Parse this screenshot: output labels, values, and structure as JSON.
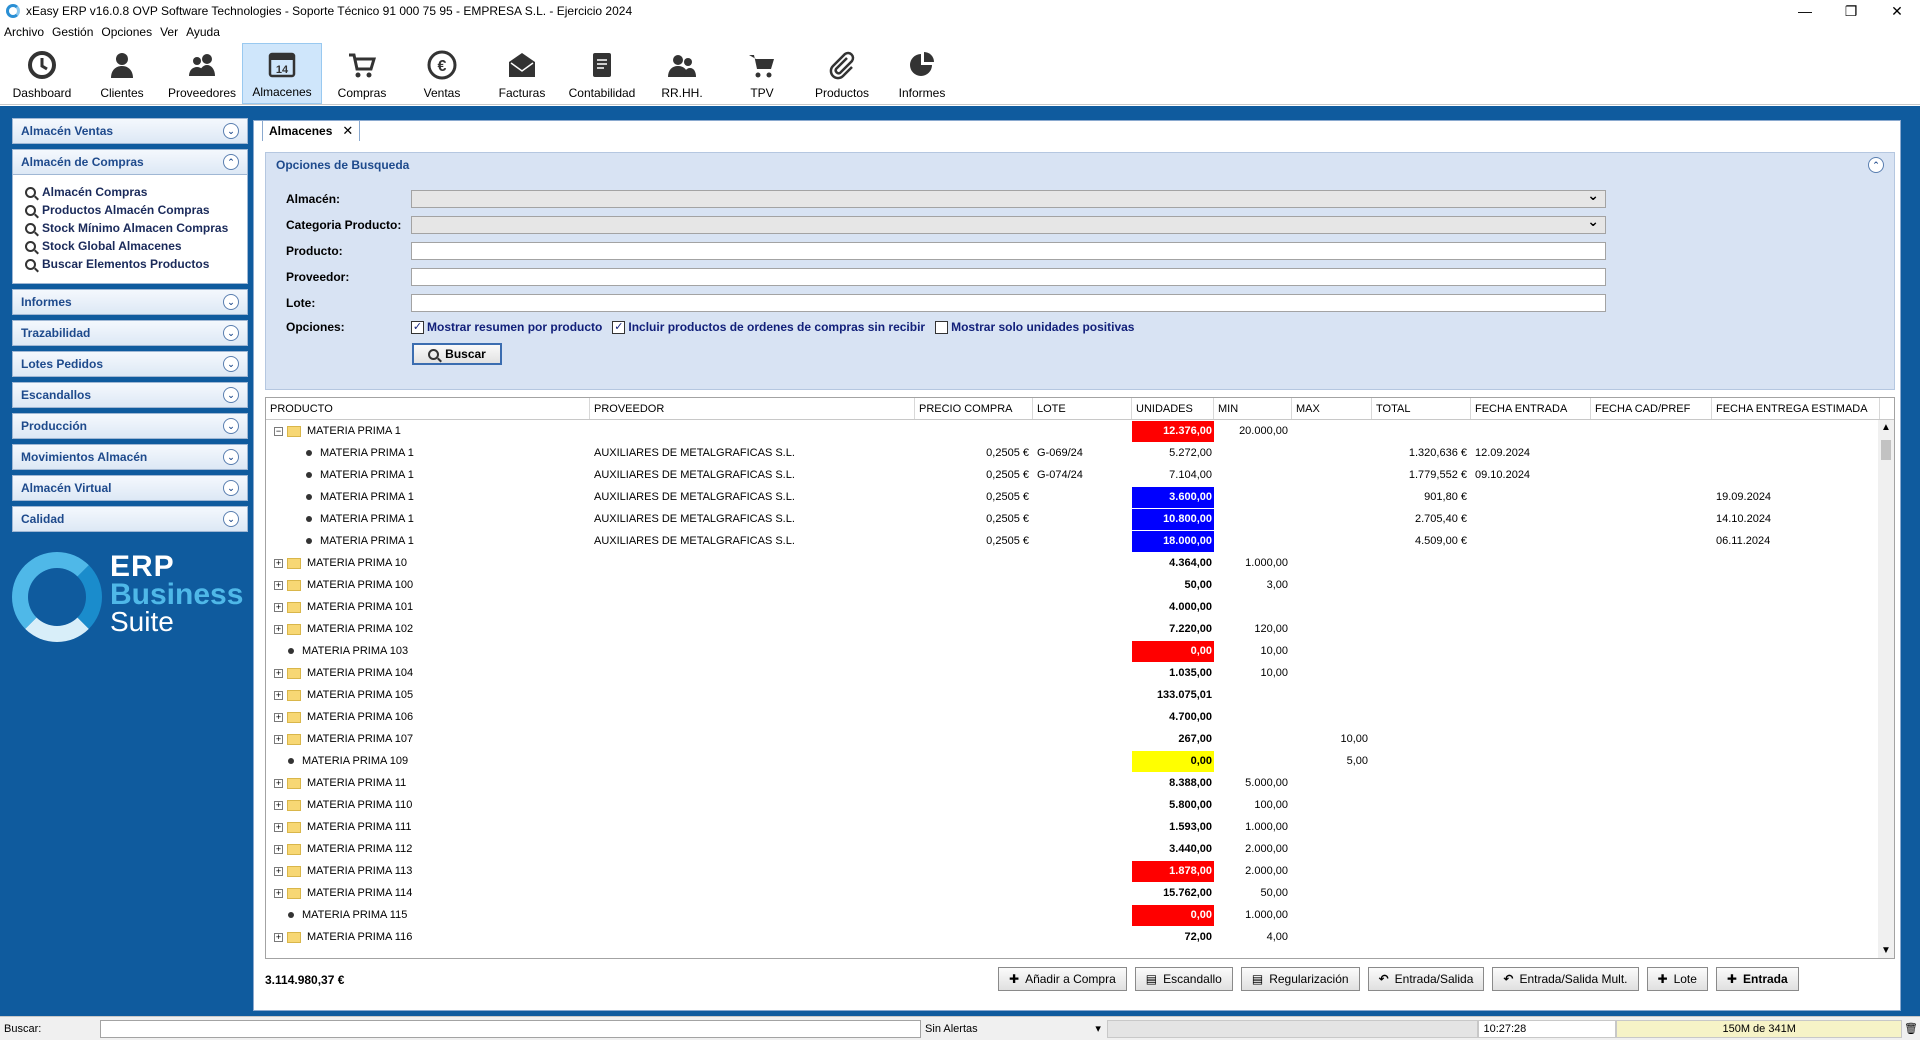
{
  "window": {
    "title": "xEasy ERP v16.0.8 OVP Software Technologies - Soporte Técnico 91 000 75 95 - EMPRESA S.L. - Ejercicio 2024",
    "minimize": "—",
    "maximize": "❐",
    "close": "✕"
  },
  "menu": [
    "Archivo",
    "Gestión",
    "Opciones",
    "Ver",
    "Ayuda"
  ],
  "toolbar": [
    {
      "label": "Dashboard",
      "icon": "clock-icon"
    },
    {
      "label": "Clientes",
      "icon": "person-icon"
    },
    {
      "label": "Proveedores",
      "icon": "people-icon"
    },
    {
      "label": "Almacenes",
      "icon": "calendar-icon",
      "day": "14",
      "active": true
    },
    {
      "label": "Compras",
      "icon": "cart-icon"
    },
    {
      "label": "Ventas",
      "icon": "euro-icon"
    },
    {
      "label": "Facturas",
      "icon": "envelope-icon"
    },
    {
      "label": "Contabilidad",
      "icon": "ledger-icon"
    },
    {
      "label": "RR.HH.",
      "icon": "staff-icon"
    },
    {
      "label": "TPV",
      "icon": "pos-cart-icon"
    },
    {
      "label": "Productos",
      "icon": "paperclip-icon"
    },
    {
      "label": "Informes",
      "icon": "pie-chart-icon"
    }
  ],
  "sidebar": {
    "sections": [
      {
        "label": "Almacén Ventas",
        "open": false
      },
      {
        "label": "Almacén de Compras",
        "open": true,
        "items": [
          "Almacén Compras",
          "Productos Almacén Compras",
          "Stock Mínimo Almacen Compras",
          "Stock Global Almacenes",
          "Buscar Elementos Productos"
        ]
      },
      {
        "label": "Informes",
        "open": false
      },
      {
        "label": "Trazabilidad",
        "open": false
      },
      {
        "label": "Lotes Pedidos",
        "open": false
      },
      {
        "label": "Escandallos",
        "open": false
      },
      {
        "label": "Producción",
        "open": false
      },
      {
        "label": "Movimientos Almacén",
        "open": false
      },
      {
        "label": "Almacén Virtual",
        "open": false
      },
      {
        "label": "Calidad",
        "open": false
      }
    ],
    "logo": {
      "line1": "ERP",
      "line2": "Business",
      "line3": "Suite"
    }
  },
  "tab": {
    "label": "Almacenes",
    "close": "✕"
  },
  "search": {
    "title": "Opciones de Busqueda",
    "fields": {
      "almacen": "Almacén:",
      "categoria": "Categoria Producto:",
      "producto": "Producto:",
      "proveedor": "Proveedor:",
      "lote": "Lote:",
      "opciones": "Opciones:"
    },
    "options": [
      {
        "label": "Mostrar resumen por producto",
        "checked": true
      },
      {
        "label": "Incluir productos de ordenes de compras sin recibir",
        "checked": true
      },
      {
        "label": "Mostrar solo unidades positivas",
        "checked": false
      }
    ],
    "button": "Buscar"
  },
  "grid": {
    "columns": [
      "PRODUCTO",
      "PROVEEDOR",
      "PRECIO COMPRA",
      "LOTE",
      "UNIDADES",
      "MIN",
      "MAX",
      "TOTAL",
      "FECHA ENTRADA",
      "FECHA CAD/PREF",
      "FECHA ENTREGA ESTIMADA"
    ],
    "rows": [
      {
        "level": 0,
        "type": "group",
        "expanded": true,
        "producto": "MATERIA PRIMA 1",
        "unidades": "12.376,00",
        "color": "red",
        "min": "20.000,00"
      },
      {
        "level": 1,
        "type": "leaf",
        "producto": "MATERIA PRIMA 1",
        "proveedor": "AUXILIARES DE METALGRAFICAS S.L.",
        "precio": "0,2505 €",
        "lote": "G-069/24",
        "unidades": "5.272,00",
        "total": "1.320,636 €",
        "fecha_entrada": "12.09.2024"
      },
      {
        "level": 1,
        "type": "leaf",
        "producto": "MATERIA PRIMA 1",
        "proveedor": "AUXILIARES DE METALGRAFICAS S.L.",
        "precio": "0,2505 €",
        "lote": "G-074/24",
        "unidades": "7.104,00",
        "total": "1.779,552 €",
        "fecha_entrada": "09.10.2024"
      },
      {
        "level": 1,
        "type": "leaf",
        "producto": "MATERIA PRIMA 1",
        "proveedor": "AUXILIARES DE METALGRAFICAS S.L.",
        "precio": "0,2505 €",
        "unidades": "3.600,00",
        "color": "blue",
        "total": "901,80 €",
        "fecha_entrega": "19.09.2024"
      },
      {
        "level": 1,
        "type": "leaf",
        "producto": "MATERIA PRIMA 1",
        "proveedor": "AUXILIARES DE METALGRAFICAS S.L.",
        "precio": "0,2505 €",
        "unidades": "10.800,00",
        "color": "blue",
        "total": "2.705,40 €",
        "fecha_entrega": "14.10.2024"
      },
      {
        "level": 1,
        "type": "leaf",
        "producto": "MATERIA PRIMA 1",
        "proveedor": "AUXILIARES DE METALGRAFICAS S.L.",
        "precio": "0,2505 €",
        "unidades": "18.000,00",
        "color": "blue",
        "total": "4.509,00 €",
        "fecha_entrega": "06.11.2024"
      },
      {
        "level": 0,
        "type": "group",
        "producto": "MATERIA PRIMA 10",
        "unidades": "4.364,00",
        "min": "1.000,00"
      },
      {
        "level": 0,
        "type": "group",
        "producto": "MATERIA PRIMA 100",
        "unidades": "50,00",
        "min": "3,00"
      },
      {
        "level": 0,
        "type": "group",
        "producto": "MATERIA PRIMA 101",
        "unidades": "4.000,00"
      },
      {
        "level": 0,
        "type": "group",
        "producto": "MATERIA PRIMA 102",
        "unidades": "7.220,00",
        "min": "120,00"
      },
      {
        "level": 0,
        "type": "single",
        "producto": "MATERIA PRIMA 103",
        "unidades": "0,00",
        "color": "red",
        "min": "10,00"
      },
      {
        "level": 0,
        "type": "group",
        "producto": "MATERIA PRIMA 104",
        "unidades": "1.035,00",
        "min": "10,00"
      },
      {
        "level": 0,
        "type": "group",
        "producto": "MATERIA PRIMA 105",
        "unidades": "133.075,01"
      },
      {
        "level": 0,
        "type": "group",
        "producto": "MATERIA PRIMA 106",
        "unidades": "4.700,00"
      },
      {
        "level": 0,
        "type": "group",
        "producto": "MATERIA PRIMA 107",
        "unidades": "267,00",
        "max": "10,00"
      },
      {
        "level": 0,
        "type": "single",
        "producto": "MATERIA PRIMA 109",
        "unidades": "0,00",
        "color": "yellow",
        "max": "5,00"
      },
      {
        "level": 0,
        "type": "group",
        "producto": "MATERIA PRIMA 11",
        "unidades": "8.388,00",
        "min": "5.000,00"
      },
      {
        "level": 0,
        "type": "group",
        "producto": "MATERIA PRIMA 110",
        "unidades": "5.800,00",
        "min": "100,00"
      },
      {
        "level": 0,
        "type": "group",
        "producto": "MATERIA PRIMA 111",
        "unidades": "1.593,00",
        "min": "1.000,00"
      },
      {
        "level": 0,
        "type": "group",
        "producto": "MATERIA PRIMA 112",
        "unidades": "3.440,00",
        "min": "2.000,00"
      },
      {
        "level": 0,
        "type": "group",
        "producto": "MATERIA PRIMA 113",
        "unidades": "1.878,00",
        "color": "red",
        "min": "2.000,00"
      },
      {
        "level": 0,
        "type": "group",
        "producto": "MATERIA PRIMA 114",
        "unidades": "15.762,00",
        "min": "50,00"
      },
      {
        "level": 0,
        "type": "single",
        "producto": "MATERIA PRIMA 115",
        "unidades": "0,00",
        "color": "red",
        "min": "1.000,00"
      },
      {
        "level": 0,
        "type": "group",
        "producto": "MATERIA PRIMA 116",
        "unidades": "72,00",
        "min": "4,00"
      }
    ]
  },
  "footer": {
    "total": "3.114.980,37 €",
    "buttons": [
      {
        "label": "Añadir a Compra",
        "icon": "plus-icon",
        "glyph": "✚"
      },
      {
        "label": "Escandallo",
        "icon": "document-icon",
        "glyph": "▤"
      },
      {
        "label": "Regularización",
        "icon": "document-icon",
        "glyph": "▤"
      },
      {
        "label": "Entrada/Salida",
        "icon": "undo-arrow-icon",
        "glyph": "↶"
      },
      {
        "label": "Entrada/Salida Mult.",
        "icon": "undo-arrow-icon",
        "glyph": "↶"
      },
      {
        "label": "Lote",
        "icon": "plus-icon",
        "glyph": "✚"
      },
      {
        "label": "Entrada",
        "icon": "plus-icon",
        "glyph": "✚",
        "bold": true
      }
    ]
  },
  "status": {
    "search_label": "Buscar:",
    "alerts": "Sin Alertas",
    "time": "10:27:28",
    "memory": "150M de 341M"
  },
  "colors": {
    "accent_blue": "#0f5b9e",
    "unit_red": "#ff0000",
    "unit_blue": "#0000ff",
    "unit_yellow": "#ffff00"
  }
}
